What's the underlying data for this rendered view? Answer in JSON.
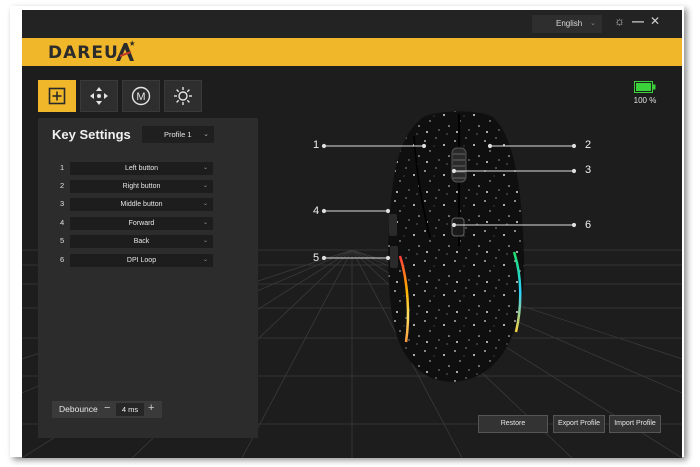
{
  "topbar": {
    "language": "English",
    "icons": [
      "gear-icon",
      "minimize-icon",
      "close-icon"
    ]
  },
  "brand": {
    "logo_text": "DAREU"
  },
  "tabs": [
    {
      "name": "key-settings",
      "icon": "plus-square-icon",
      "active": true
    },
    {
      "name": "dpi",
      "icon": "move-arrows-icon",
      "active": false
    },
    {
      "name": "macro",
      "icon": "m-circle-icon",
      "active": false
    },
    {
      "name": "lighting",
      "icon": "sun-icon",
      "active": false
    }
  ],
  "battery": {
    "level": 100,
    "label": "100 %",
    "color": "#3ad13a"
  },
  "panel": {
    "title": "Key Settings",
    "profile": "Profile 1",
    "keys": [
      {
        "num": "1",
        "action": "Left button"
      },
      {
        "num": "2",
        "action": "Right button"
      },
      {
        "num": "3",
        "action": "Middle button"
      },
      {
        "num": "4",
        "action": "Forward"
      },
      {
        "num": "5",
        "action": "Back"
      },
      {
        "num": "6",
        "action": "DPI Loop"
      }
    ],
    "debounce": {
      "label": "Debounce",
      "value": "4 ms",
      "minus": "−",
      "plus": "+"
    }
  },
  "callouts": [
    "1",
    "2",
    "3",
    "4",
    "5",
    "6"
  ],
  "buttons": {
    "restore": "Restore",
    "export": "Export Profile",
    "import": "Import Profile"
  },
  "colors": {
    "accent": "#f1b72b",
    "background": "#1d1d1d",
    "panel": "#2c2c2c"
  }
}
